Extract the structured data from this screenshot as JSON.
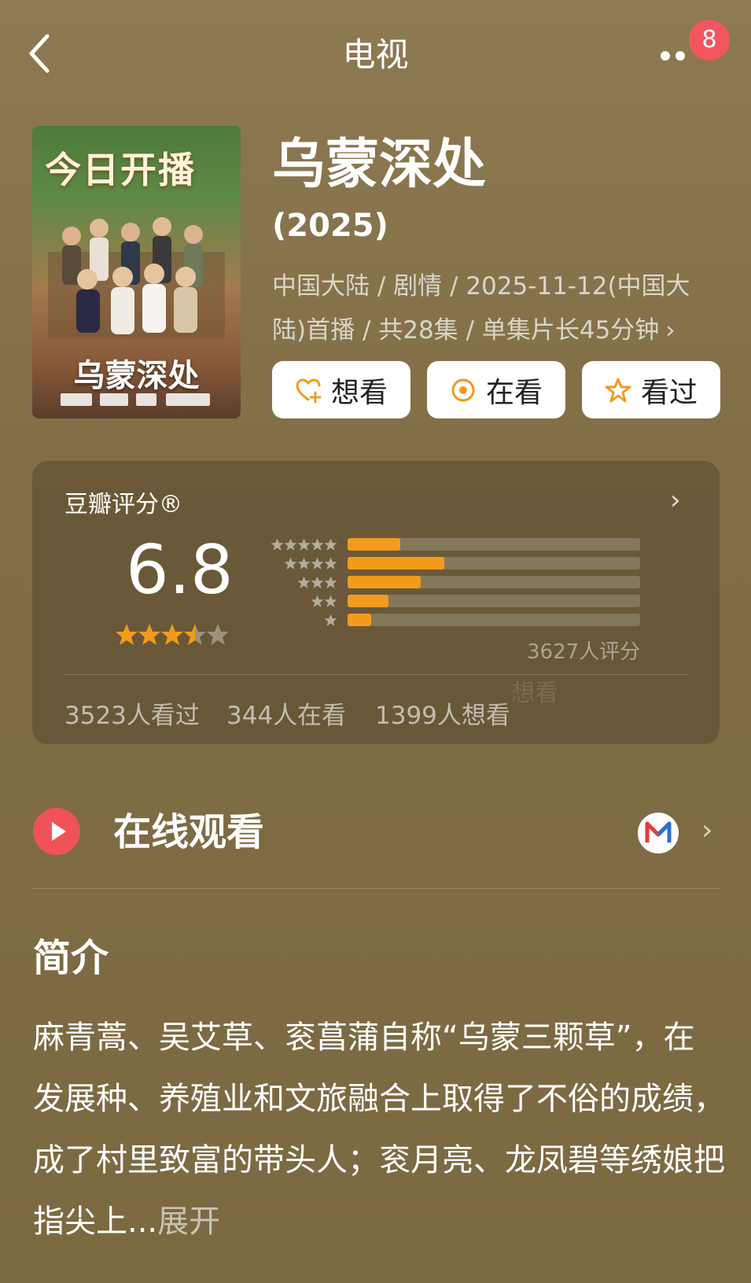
{
  "header": {
    "title": "电视",
    "badge_count": "8"
  },
  "poster": {
    "headline": "今日开播",
    "title": "乌蒙深处"
  },
  "show": {
    "title": "乌蒙深处",
    "year": "(2025)",
    "meta": "中国大陆 / 剧情 / 2025-11-12(中国大陆)首播 / 共28集 / 单集片长45分钟"
  },
  "actions": {
    "want": "想看",
    "watching": "在看",
    "watched": "看过"
  },
  "rating": {
    "label": "豆瓣评分®",
    "score": "6.8",
    "stars": 3.5,
    "distribution": [
      {
        "stars": 5,
        "fraction": 0.18
      },
      {
        "stars": 4,
        "fraction": 0.33
      },
      {
        "stars": 3,
        "fraction": 0.25
      },
      {
        "stars": 2,
        "fraction": 0.14
      },
      {
        "stars": 1,
        "fraction": 0.08
      }
    ],
    "count_text": "3627人评分",
    "ghost_text": "想看"
  },
  "stats": {
    "watched": "3523人看过",
    "watching": "344人在看",
    "want": "1399人想看"
  },
  "online": {
    "label": "在线观看"
  },
  "synopsis": {
    "heading": "简介",
    "text": "麻青蒿、吴艾草、衮菖蒲自称“乌蒙三颗草”，在发展种、养殖业和文旅融合上取得了不俗的成绩，成了村里致富的带头人；衮月亮、龙凤碧等绣娘把指尖上...",
    "expand": "展开"
  },
  "colors": {
    "accent": "#f29b1d",
    "badge": "#f2565f",
    "play": "#f0525a"
  }
}
